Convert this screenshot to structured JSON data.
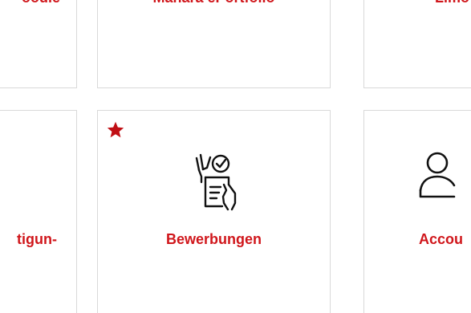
{
  "tiles_top": [
    {
      "label": "oodle"
    },
    {
      "label": "Mahara ePortfolio"
    },
    {
      "label": "Limo"
    }
  ],
  "tiles_bottom": [
    {
      "label": "tigun-"
    },
    {
      "label": "Bewerbungen",
      "favorite": true,
      "icon": "application-form-icon"
    },
    {
      "label": "Accou",
      "icon": "user-icon"
    }
  ],
  "colors": {
    "accent": "#d0161b",
    "border": "#d9d9d9",
    "icon": "#111111"
  }
}
